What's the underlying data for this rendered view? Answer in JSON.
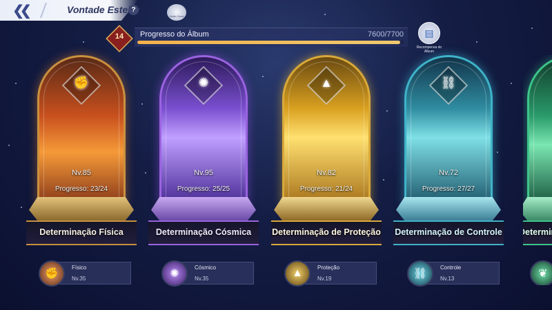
{
  "header": {
    "title": "Vontade Estelar",
    "help_icon": "?",
    "view_set_label": "Visão Geral"
  },
  "progress": {
    "level": "14",
    "label": "Progresso do Álbum",
    "value_text": "7600/7700",
    "current": 7600,
    "max": 7700
  },
  "album_reward": {
    "label": "Recompensa do Álbum"
  },
  "colors": {
    "physical": "#e07a2a",
    "cosmic": "#8b4fd6",
    "protection": "#e8b530",
    "control": "#3fb3c9",
    "fifth": "#3ec48a"
  },
  "cards": [
    {
      "name": "Determinação Física",
      "level": "Nv.85",
      "progress": "Progresso: 23/24",
      "icon": "fist-icon"
    },
    {
      "name": "Determinação Cósmica",
      "level": "Nv.95",
      "progress": "Progresso: 25/25",
      "icon": "cosmic-swirl-icon"
    },
    {
      "name": "Determinação de Proteção",
      "level": "Nv.82",
      "progress": "Progresso: 21/24",
      "icon": "shield-spire-icon"
    },
    {
      "name": "Determinação de Controle",
      "level": "Nv.72",
      "progress": "Progresso: 27/27",
      "icon": "chain-link-icon"
    },
    {
      "name": "Determin",
      "level": "",
      "progress": "",
      "icon": "leaf-icon"
    }
  ],
  "tags": [
    {
      "name": "Físico",
      "level": "Nv.35",
      "icon": "fist-icon"
    },
    {
      "name": "Cósmico",
      "level": "Nv.35",
      "icon": "cosmic-swirl-icon"
    },
    {
      "name": "Proteção",
      "level": "Nv.19",
      "icon": "shield-spire-icon"
    },
    {
      "name": "Controle",
      "level": "Nv.13",
      "icon": "chain-link-icon"
    },
    {
      "name": "",
      "level": "",
      "icon": "leaf-icon"
    }
  ]
}
